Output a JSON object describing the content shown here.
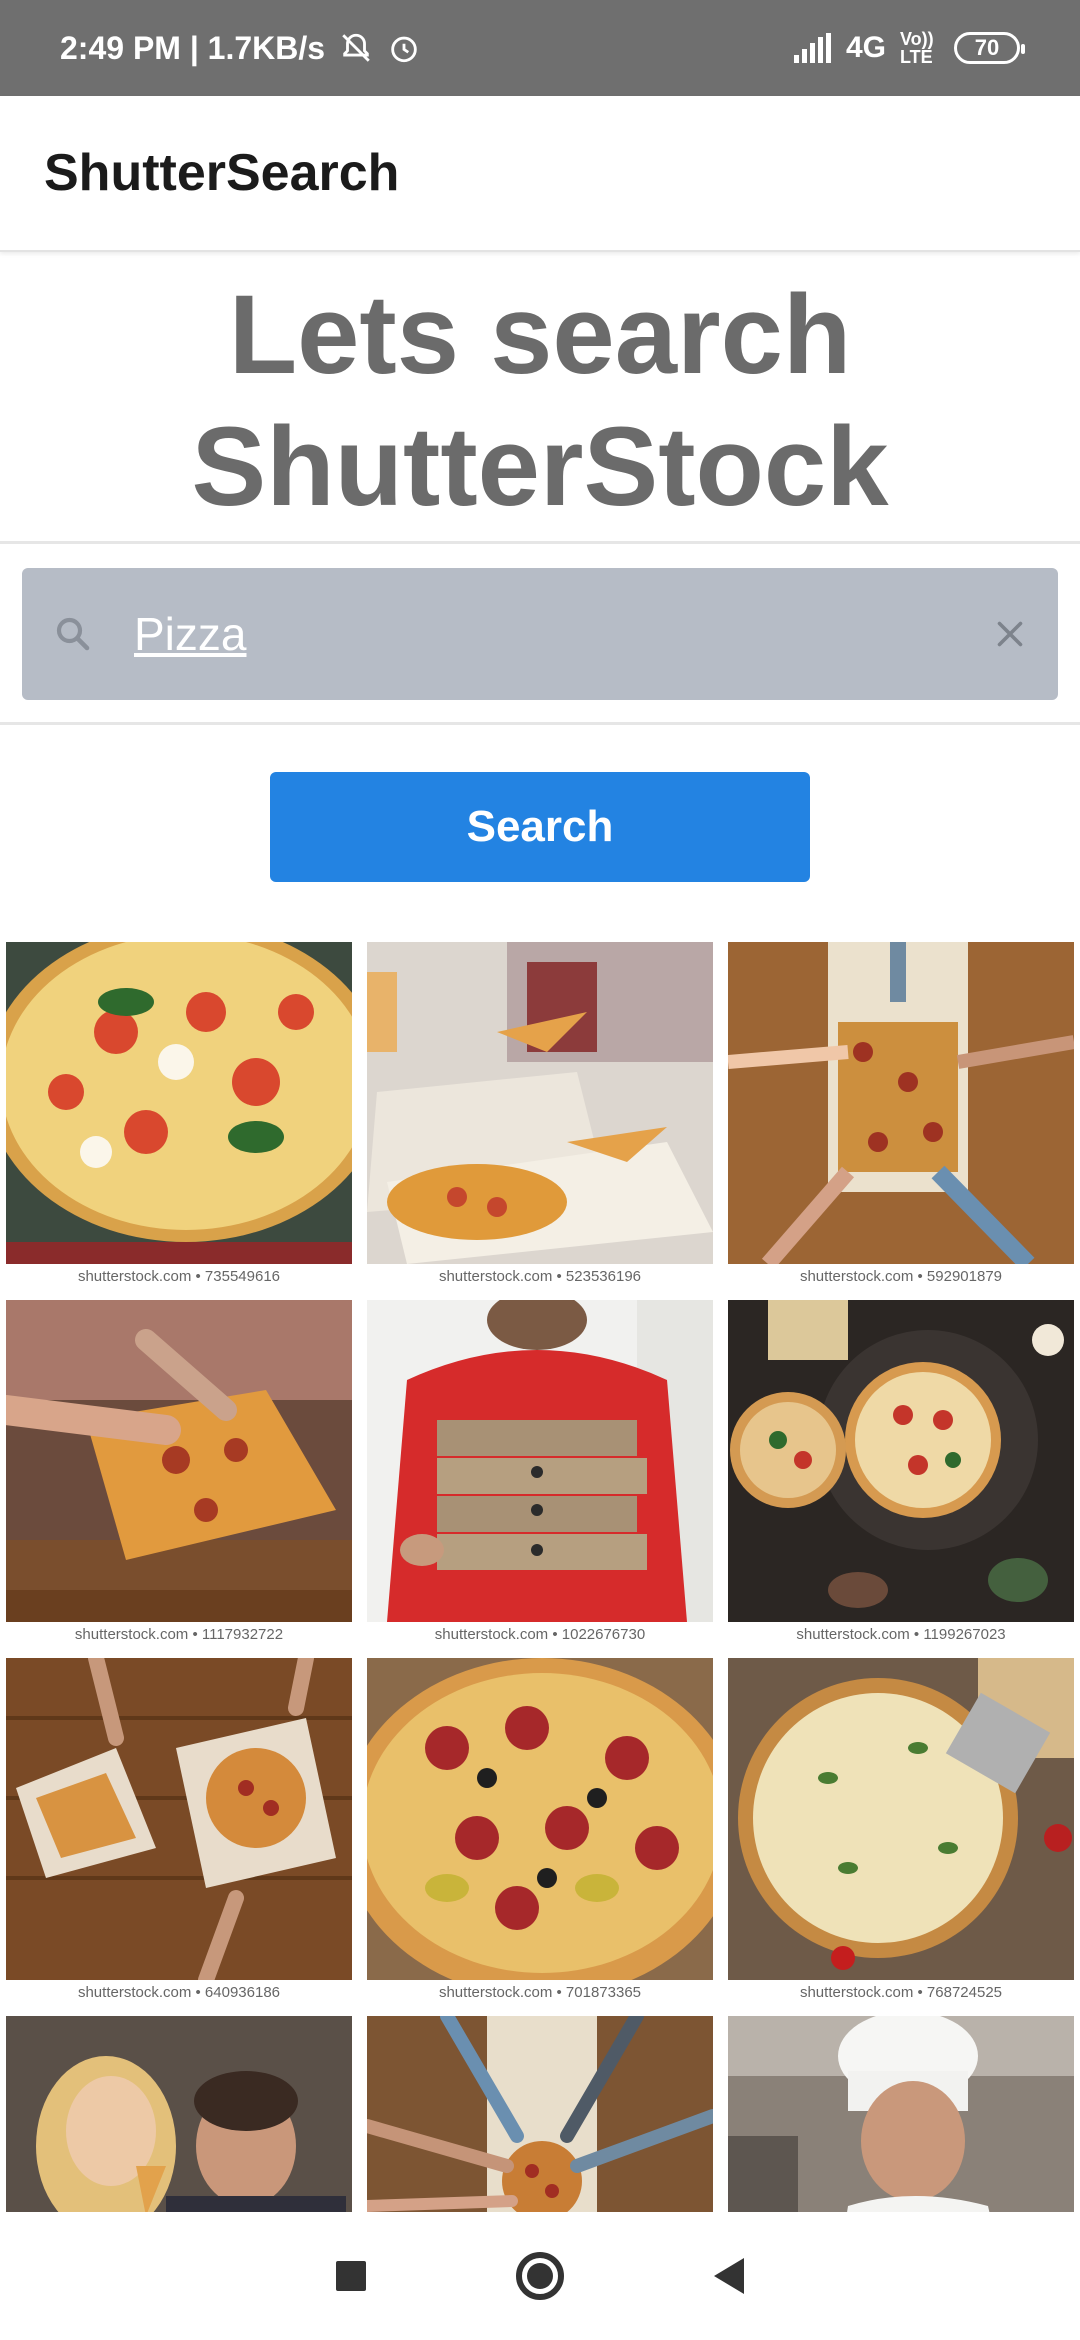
{
  "status_bar": {
    "time_speed": "2:49 PM | 1.7KB/s",
    "network": "4G",
    "volte": "Vo)) LTE",
    "battery": "70"
  },
  "app_bar": {
    "title": "ShutterSearch"
  },
  "hero": {
    "line1": "Lets search",
    "line2": "ShutterStock"
  },
  "search": {
    "query": "Pizza"
  },
  "search_button": {
    "label": "Search"
  },
  "results": [
    {
      "caption": "shutterstock.com • 735549616",
      "subject": "pizza with basil and tomato"
    },
    {
      "caption": "shutterstock.com • 523536196",
      "subject": "friends sharing boxed pizza"
    },
    {
      "caption": "shutterstock.com • 592901879",
      "subject": "hands taking pizza slices"
    },
    {
      "caption": "shutterstock.com • 1117932722",
      "subject": "people taking pizza slices"
    },
    {
      "caption": "shutterstock.com • 1022676730",
      "subject": "delivery man with pizza boxes"
    },
    {
      "caption": "shutterstock.com • 1199267023",
      "subject": "pizzas on dark table"
    },
    {
      "caption": "shutterstock.com • 640936186",
      "subject": "hands with pizza boxes on table"
    },
    {
      "caption": "shutterstock.com • 701873365",
      "subject": "pepperoni olive pizza closeup"
    },
    {
      "caption": "shutterstock.com • 768724525",
      "subject": "cheese pizza with grater"
    },
    {
      "caption": "",
      "subject": "couple eating pizza"
    },
    {
      "caption": "",
      "subject": "hands around pizza box"
    },
    {
      "caption": "",
      "subject": "chef in white hat"
    }
  ]
}
